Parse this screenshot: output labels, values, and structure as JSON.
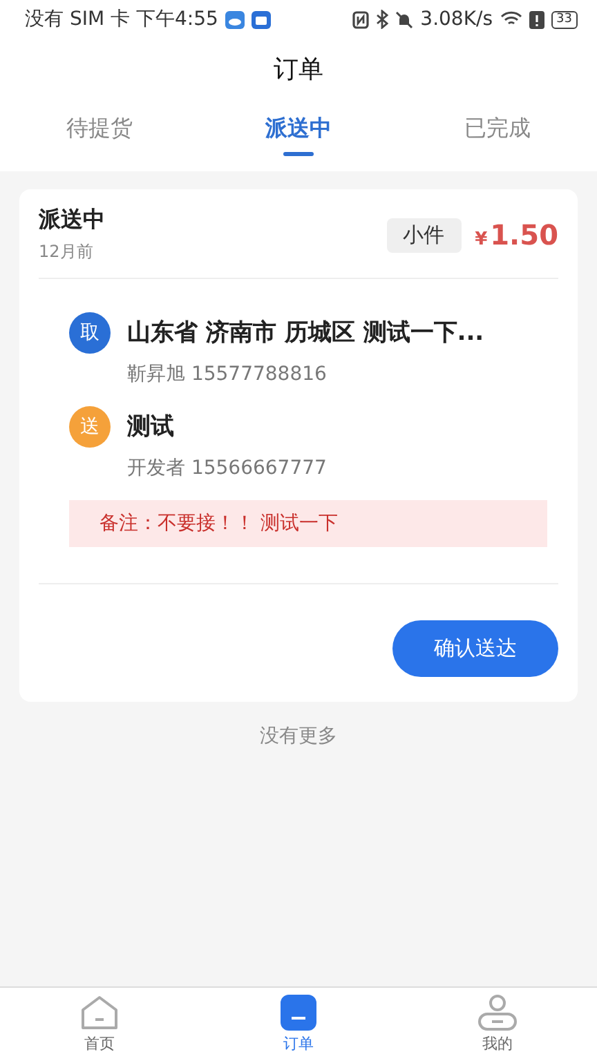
{
  "status_bar": {
    "carrier_time": "没有 SIM 卡 下午4:55",
    "speed": "3.08K/s",
    "battery": "33"
  },
  "title": "订单",
  "tabs": [
    {
      "label": "待提货",
      "selected": false
    },
    {
      "label": "派送中",
      "selected": true
    },
    {
      "label": "已完成",
      "selected": false
    }
  ],
  "orders": [
    {
      "status": "派送中",
      "time": "12月前",
      "size_tag": "小件",
      "currency": "¥",
      "price": "1.50",
      "stops": [
        {
          "kind": "pickup",
          "badge": "取",
          "address": "山东省 济南市 历城区 测试一下...",
          "contact": "靳昇旭 15577788816"
        },
        {
          "kind": "delivery",
          "badge": "送",
          "address": "测试",
          "contact": "开发者 15566667777"
        }
      ],
      "note": "备注：不要接！！ 测试一下",
      "action": "确认送达"
    }
  ],
  "end_text": "没有更多",
  "bottom_nav": [
    {
      "label": "首页",
      "kind": "home",
      "selected": false
    },
    {
      "label": "订单",
      "kind": "orders",
      "selected": true
    },
    {
      "label": "我的",
      "kind": "profile",
      "selected": false
    }
  ]
}
